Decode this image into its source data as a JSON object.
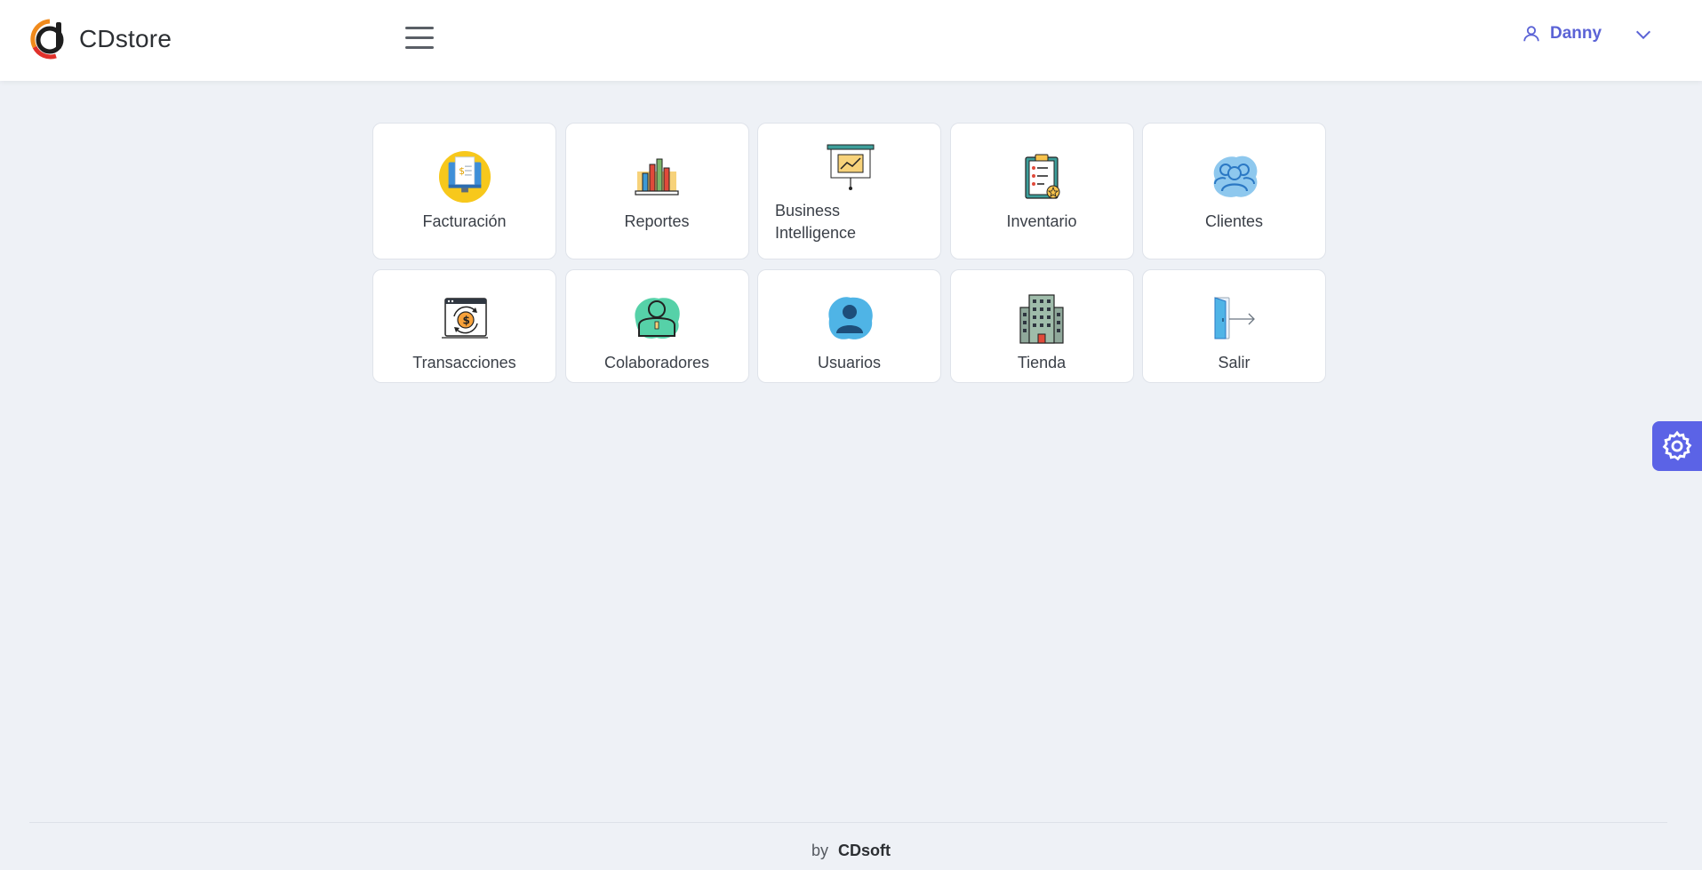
{
  "header": {
    "brand": "CDstore",
    "user_name": "Danny"
  },
  "tiles": [
    {
      "label": "Facturación",
      "icon": "invoice-monitor-icon"
    },
    {
      "label": "Reportes",
      "icon": "bar-chart-icon"
    },
    {
      "label": "Business Intelligence",
      "icon": "presentation-board-icon"
    },
    {
      "label": "Inventario",
      "icon": "clipboard-checklist-icon"
    },
    {
      "label": "Clientes",
      "icon": "users-group-icon"
    },
    {
      "label": "Transacciones",
      "icon": "money-exchange-icon"
    },
    {
      "label": "Colaboradores",
      "icon": "collaborator-icon"
    },
    {
      "label": "Usuarios",
      "icon": "user-icon"
    },
    {
      "label": "Tienda",
      "icon": "building-icon"
    },
    {
      "label": "Salir",
      "icon": "exit-door-icon"
    }
  ],
  "footer": {
    "prefix": "by",
    "company": "CDsoft"
  },
  "colors": {
    "accent": "#5b63e6",
    "background": "#eef1f6",
    "logo_orange": "#f08a1c",
    "logo_red": "#e0312b"
  }
}
